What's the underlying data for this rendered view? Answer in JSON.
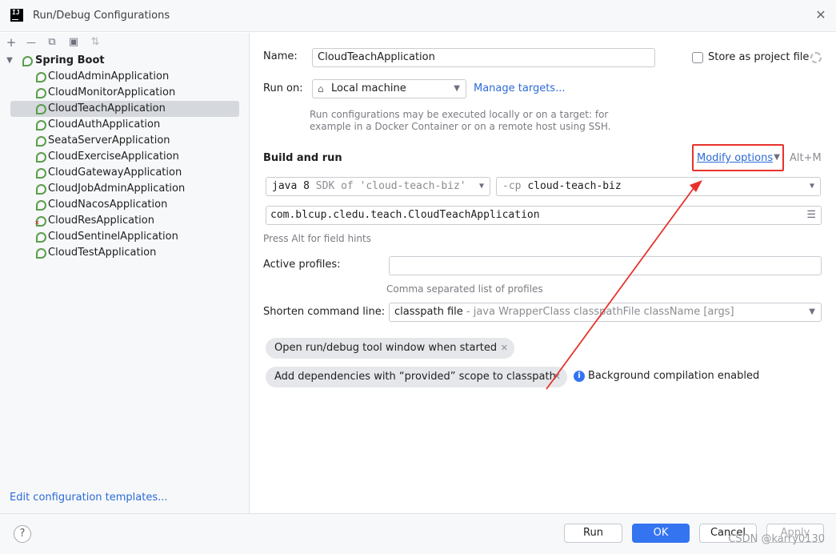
{
  "window": {
    "title": "Run/Debug Configurations"
  },
  "toolbar": {
    "add": "+",
    "remove": "—",
    "copy": "⧉",
    "folder": "▣",
    "sort": "⇅"
  },
  "tree": {
    "root": "Spring Boot",
    "items": [
      {
        "label": "CloudAdminApplication",
        "icon": "spring-boot-icon",
        "error": false
      },
      {
        "label": "CloudMonitorApplication",
        "icon": "spring-boot-icon",
        "error": false
      },
      {
        "label": "CloudTeachApplication",
        "icon": "spring-boot-icon",
        "error": false,
        "selected": true
      },
      {
        "label": "CloudAuthApplication",
        "icon": "spring-boot-icon",
        "error": false
      },
      {
        "label": "SeataServerApplication",
        "icon": "spring-boot-icon",
        "error": false
      },
      {
        "label": "CloudExerciseApplication",
        "icon": "spring-boot-icon",
        "error": false
      },
      {
        "label": "CloudGatewayApplication",
        "icon": "spring-boot-icon",
        "error": false
      },
      {
        "label": "CloudJobAdminApplication",
        "icon": "spring-boot-icon",
        "error": false
      },
      {
        "label": "CloudNacosApplication",
        "icon": "spring-boot-icon",
        "error": false
      },
      {
        "label": "CloudResApplication",
        "icon": "spring-boot-icon",
        "error": true
      },
      {
        "label": "CloudSentinelApplication",
        "icon": "spring-boot-icon",
        "error": false
      },
      {
        "label": "CloudTestApplication",
        "icon": "spring-boot-icon",
        "error": false
      }
    ],
    "edit_templates": "Edit configuration templates..."
  },
  "form": {
    "name_label": "Name:",
    "name_value": "CloudTeachApplication",
    "store_label": "Store as project file",
    "runon_label": "Run on:",
    "runon_value": "Local machine",
    "manage_targets": "Manage targets...",
    "runon_hint_1": "Run configurations may be executed locally or on a target: for",
    "runon_hint_2": "example in a Docker Container or on a remote host using SSH.",
    "build_run": "Build and run",
    "modify_options": "Modify options",
    "modify_shortcut": "Alt+M",
    "jdk_java": "java 8",
    "jdk_sdk": "SDK of 'cloud-teach-biz'",
    "cp_flag": "-cp",
    "cp_value": "cloud-teach-biz",
    "main_class": "com.blcup.cledu.teach.CloudTeachApplication",
    "field_hints": "Press Alt for field hints",
    "profiles_label": "Active profiles:",
    "profiles_value": "",
    "profiles_hint": "Comma separated list of profiles",
    "shorten_label": "Shorten command line:",
    "shorten_value": "classpath file",
    "shorten_desc": "- java WrapperClass classpathFile className [args]",
    "chip_1": "Open run/debug tool window when started",
    "chip_2": "Add dependencies with “provided” scope to classpath",
    "bg_info": "Background compilation enabled"
  },
  "buttons": {
    "help": "?",
    "run": "Run",
    "ok": "OK",
    "cancel": "Cancel",
    "apply": "Apply"
  },
  "watermark": "CSDN @karry0130",
  "colors": {
    "accent": "#3574f0",
    "link": "#2c6bd6",
    "annotation": "#e8322d",
    "spring": "#5a9e4b"
  }
}
